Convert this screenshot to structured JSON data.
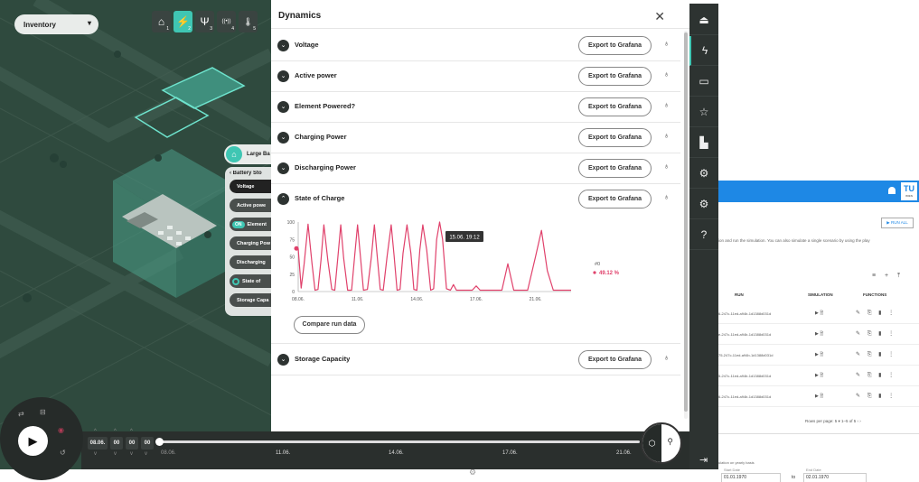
{
  "map": {
    "inventory_select": "Inventory",
    "layers": [
      {
        "icon": "home-icon",
        "glyph": "⌂",
        "num": "1"
      },
      {
        "icon": "bolt-icon",
        "glyph": "⚡",
        "num": "2"
      },
      {
        "icon": "tower-icon",
        "glyph": "Ψ",
        "num": "3"
      },
      {
        "icon": "antenna-icon",
        "glyph": "((•))",
        "num": "4"
      },
      {
        "icon": "thermometer-icon",
        "glyph": "🌡",
        "num": "5"
      }
    ],
    "side_tab": "Large Ba",
    "battery_title": "Battery Sto",
    "battery_items": [
      "Voltage",
      "Active powe",
      "Element",
      "Charging Pow",
      "Discharging",
      "State of",
      "Storage Capa"
    ],
    "on_label": "ON"
  },
  "dynamics": {
    "title": "Dynamics",
    "close": "✕",
    "export_label": "Export to Grafana",
    "compare_label": "Compare run data",
    "rows": [
      {
        "label": "Voltage",
        "expanded": false
      },
      {
        "label": "Active power",
        "expanded": false
      },
      {
        "label": "Element Powered?",
        "expanded": false
      },
      {
        "label": "Charging Power",
        "expanded": false
      },
      {
        "label": "Discharging Power",
        "expanded": false
      },
      {
        "label": "State of Charge",
        "expanded": true
      }
    ],
    "last_row": {
      "label": "Storage Capacity",
      "expanded": false
    }
  },
  "chart_data": {
    "type": "line",
    "title": "",
    "xlabel": "",
    "ylabel": "",
    "ylim": [
      0,
      100
    ],
    "y_ticks": [
      "100",
      "75",
      "50",
      "25",
      "0"
    ],
    "x_ticks": [
      "08.06.",
      "11.06.",
      "14.06.",
      "17.06.",
      "21.06."
    ],
    "tooltip": "15.06. 19:12",
    "legend_series": "#0",
    "legend_value": "49.12 %",
    "series_color": "#e0416b",
    "series": [
      {
        "x": [
          8.0,
          8.15,
          8.3,
          8.5,
          8.7,
          8.85,
          9.0,
          9.15,
          9.3,
          9.5,
          9.7,
          9.85,
          10.0,
          10.15,
          10.3,
          10.5,
          10.7,
          10.85,
          11.0,
          11.15,
          11.3,
          11.5,
          11.7,
          11.85,
          12.0,
          12.15,
          12.3,
          12.5,
          12.7,
          12.85,
          13.0,
          13.15,
          13.3,
          13.5,
          13.7,
          13.85,
          14.0,
          14.15,
          14.3,
          14.5,
          14.7,
          14.85,
          15.0,
          15.15,
          15.3,
          15.5,
          15.7,
          15.85,
          16.0,
          16.2,
          16.5,
          16.8,
          17.0,
          17.2,
          17.6,
          17.9,
          18.1,
          18.3,
          18.6,
          18.9,
          19.1,
          19.3,
          19.6,
          20.0,
          20.3,
          20.6,
          20.9,
          21.2,
          21.5,
          21.8
        ],
        "y": [
          62,
          5,
          40,
          97,
          40,
          2,
          3,
          45,
          96,
          45,
          3,
          2,
          48,
          96,
          48,
          2,
          2,
          50,
          96,
          50,
          2,
          3,
          50,
          96,
          50,
          3,
          2,
          52,
          96,
          52,
          2,
          3,
          55,
          96,
          55,
          3,
          2,
          60,
          96,
          60,
          2,
          4,
          75,
          100,
          75,
          4,
          2,
          10,
          2,
          2,
          2,
          2,
          8,
          2,
          2,
          2,
          2,
          2,
          40,
          2,
          2,
          2,
          2,
          50,
          88,
          30,
          2,
          2,
          2,
          2
        ]
      }
    ]
  },
  "nav": {
    "items": [
      "stack-icon",
      "bolt-icon",
      "panel-icon",
      "star-icon",
      "buildings-icon",
      "gear-badge-icon",
      "settings-icon",
      "help-icon"
    ],
    "glyphs": [
      "⏏",
      "ϟ",
      "▭",
      "☆",
      "▙",
      "⚙",
      "⚙",
      "?"
    ],
    "logout_glyph": "⇥"
  },
  "bgapp": {
    "logo": "TU",
    "logo_sub": "WIEN",
    "runall": "▶ RUN ALL",
    "intro": "ion and run the simulation. You can also simulate a single scenario by using the play",
    "tools": "≡ + ⤒",
    "headers": {
      "run": "RUN",
      "simulation": "SIMULATION",
      "functions": "FUNCTIONS"
    },
    "rows": [
      "6-247c-11ed-a94b-1d1388d031d",
      "e-247c-11ed-a94b-1d1388d031d",
      "75-247c-11ed-a94b-1d1388d031d",
      "5-247c-11ed-a94b-1d1388d031d",
      "6-247c-11ed-a94b-1d1388d031d"
    ],
    "sim_glyphs": "▶  🗎",
    "fn_glyphs": "✎ ⎘ ▮ ⋮",
    "pager": "Rows per page:   5 ▾      1–5 of 5     ‹   ›",
    "note": "ulation on yearly basis",
    "start_label": "Start Date",
    "start_value": "01.01.1970",
    "end_label": "End Date",
    "end_value": "02.01.1970",
    "to": "to"
  },
  "timeline": {
    "play": "▶",
    "date": [
      "08.06.",
      "00",
      "00",
      "00"
    ],
    "ticks": [
      "08.06.",
      "11.06.",
      "14.06.",
      "17.06.",
      "21.06."
    ],
    "side_icons": [
      "⇄",
      "⊟",
      "◉",
      "↺"
    ],
    "cube": "⬡",
    "pin": "⚲"
  }
}
